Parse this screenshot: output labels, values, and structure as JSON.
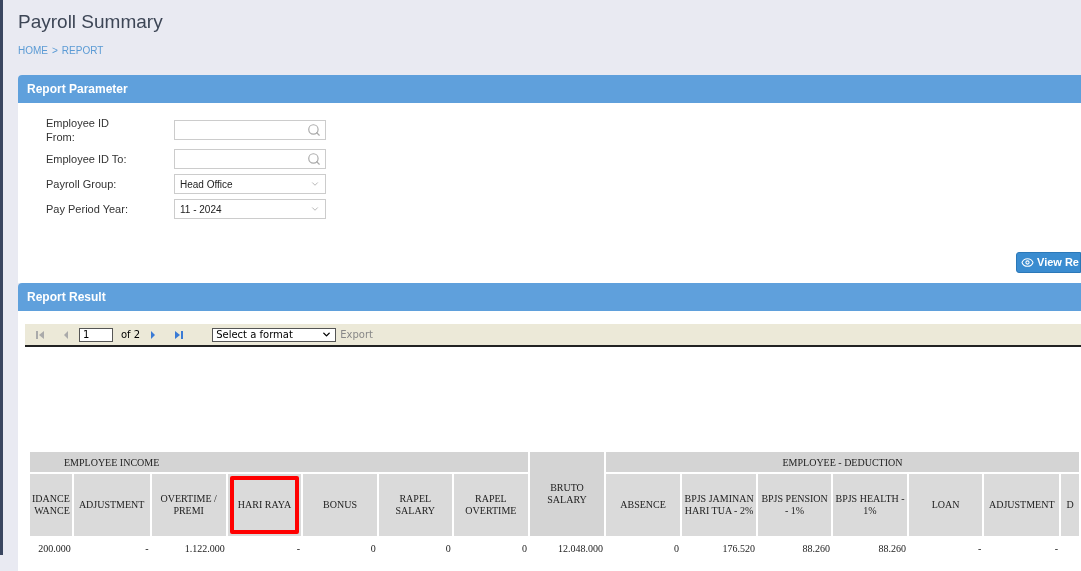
{
  "page": {
    "title": "Payroll Summary",
    "breadcrumb": [
      "HOME",
      ">",
      "REPORT"
    ]
  },
  "parameter_panel": {
    "title": "Report Parameter",
    "fields": [
      {
        "kind": "lookup",
        "label": "Employee ID From:"
      },
      {
        "kind": "lookup",
        "label": "Employee ID To:"
      },
      {
        "kind": "select",
        "label": "Payroll Group:",
        "value": "Head Office"
      },
      {
        "kind": "select",
        "label": "Pay Period Year:",
        "value": "11 - 2024"
      }
    ],
    "button": "View Re"
  },
  "result_panel": {
    "title": "Report Result",
    "toolbar": {
      "page": "1",
      "of": "of 2",
      "format": "Select a format",
      "export": "Export"
    },
    "table": {
      "header_groups": [
        {
          "label": "EMPLOYEE INCOME",
          "columns": [
            {
              "label": "IDANCE WANCE",
              "highlighted": false
            },
            {
              "label": "ADJUSTMENT",
              "highlighted": false
            },
            {
              "label": "OVERTIME / PREMI",
              "highlighted": false
            },
            {
              "label": "HARI RAYA",
              "highlighted": true
            },
            {
              "label": "BONUS",
              "highlighted": false
            },
            {
              "label": "RAPEL SALARY",
              "highlighted": false
            },
            {
              "label": "RAPEL OVERTIME",
              "highlighted": false
            }
          ]
        },
        {
          "columns": [
            {
              "label": "BRUTO SALARY",
              "highlighted": false
            }
          ]
        },
        {
          "label": "EMPLOYEE - DEDUCTION",
          "columns": [
            {
              "label": "ABSENCE",
              "highlighted": false
            },
            {
              "label": "BPJS JAMINAN HARI TUA - 2%",
              "highlighted": false
            },
            {
              "label": "BPJS PENSION - 1%",
              "highlighted": false
            },
            {
              "label": "BPJS HEALTH - 1%",
              "highlighted": false
            },
            {
              "label": "LOAN",
              "highlighted": false
            },
            {
              "label": "ADJUSTMENT",
              "highlighted": false
            },
            {
              "label": "D",
              "highlighted": false
            }
          ]
        }
      ],
      "rows": [
        [
          "200.000",
          "-",
          "1.122.000",
          "-",
          "0",
          "0",
          "0",
          "12.048.000",
          "0",
          "176.520",
          "88.260",
          "88.260",
          "-",
          "-"
        ]
      ]
    }
  }
}
